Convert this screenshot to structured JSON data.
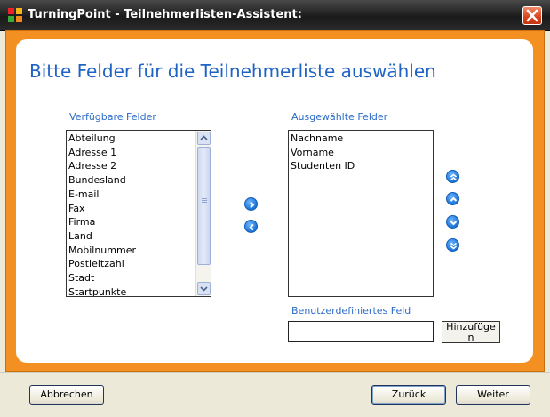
{
  "window": {
    "title": "TurningPoint - Teilnehmerlisten-Assistent:",
    "icon": "turningpoint-app-icon",
    "close_icon": "close-icon"
  },
  "main": {
    "heading": "Bitte Felder für die Teilnehmerliste auswählen",
    "available_label": "Verfügbare Felder",
    "available_items": [
      "Abteilung",
      "Adresse 1",
      "Adresse 2",
      "Bundesland",
      "E-mail",
      "Fax",
      "Firma",
      "Land",
      "Mobilnummer",
      "Postleitzahl",
      "Stadt",
      "Startpunkte"
    ],
    "selected_label": "Ausgewählte Felder",
    "selected_items": [
      "Nachname",
      "Vorname",
      "Studenten ID"
    ],
    "custom_field_label": "Benutzerdefiniertes Feld",
    "custom_field_value": "",
    "add_button_label": "Hinzufüge n"
  },
  "footer": {
    "cancel_label": "Abbrechen",
    "back_label": "Zurück",
    "next_label": "Weiter"
  },
  "colors": {
    "accent_orange": "#f39021",
    "heading_blue": "#1f63c4",
    "button_blue": "#1b73d6"
  }
}
